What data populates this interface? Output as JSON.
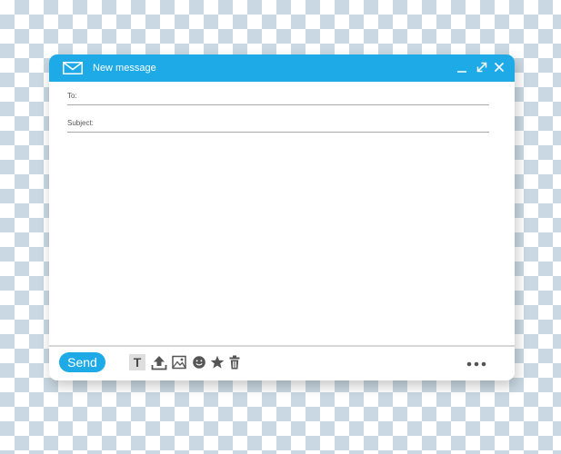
{
  "window": {
    "title": "New message"
  },
  "fields": {
    "to_label": "To:",
    "to_value": "",
    "subject_label": "Subject:",
    "subject_value": ""
  },
  "body": {
    "value": ""
  },
  "footer": {
    "send_label": "Send",
    "text_tool_glyph": "T"
  },
  "icons": {
    "mail": "envelope-icon",
    "minimize": "minimize-icon",
    "maximize": "expand-icon",
    "close": "close-icon",
    "text_format": "text-format-icon",
    "upload": "upload-icon",
    "image": "image-icon",
    "emoji": "emoji-icon",
    "star": "star-icon",
    "trash": "trash-icon",
    "more": "more-dots-icon"
  },
  "colors": {
    "accent": "#1eaae7",
    "icon_gray": "#555555",
    "rule_gray": "#a9a9a9",
    "checker": "#c9d8e2"
  }
}
